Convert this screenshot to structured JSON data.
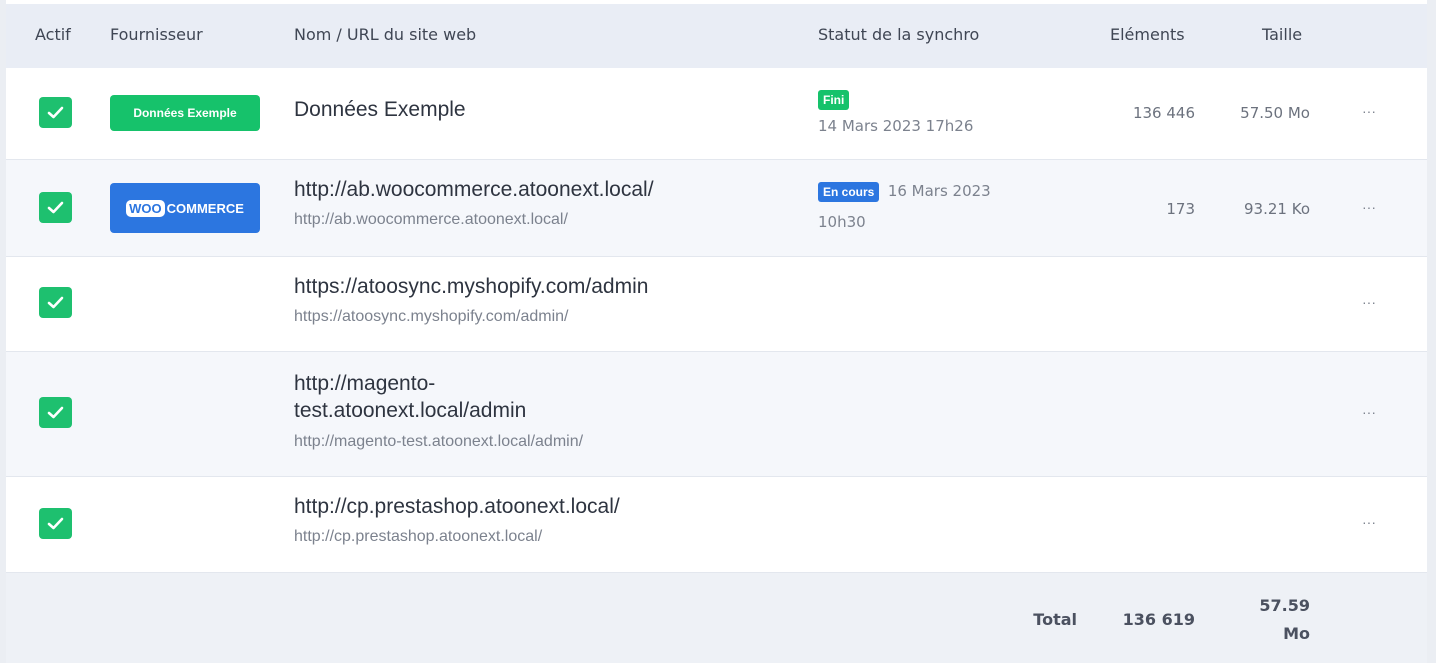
{
  "header": {
    "actif": "Actif",
    "fournisseur": "Fournisseur",
    "nom": "Nom / URL du site web",
    "statut": "Statut de la synchro",
    "elements": "Eléments",
    "taille": "Taille"
  },
  "rows": [
    {
      "active": true,
      "provider": "Données Exemple",
      "name": "Données Exemple",
      "url": "",
      "status_label": "Fini",
      "status_date": "14 Mars 2023 17h26",
      "elements": "136 446",
      "size": "57.50 Mo",
      "menu": "···"
    },
    {
      "active": true,
      "provider_mark": "WOO",
      "provider_text": "COMMERCE",
      "name": "http://ab.woocommerce.atoonext.local/",
      "url": "http://ab.woocommerce.atoonext.local/",
      "status_label": "En cours",
      "status_date_1": "16 Mars 2023",
      "status_date_2": "10h30",
      "elements": "173",
      "size": "93.21 Ko",
      "menu": "···"
    },
    {
      "active": true,
      "name": "https://atoosync.myshopify.com/admin",
      "url": "https://atoosync.myshopify.com/admin/",
      "menu": "···"
    },
    {
      "active": true,
      "name_1": "http://magento-",
      "name_2": "test.atoonext.local/admin",
      "url": "http://magento-test.atoonext.local/admin/",
      "menu": "···"
    },
    {
      "active": true,
      "name": "http://cp.prestashop.atoonext.local/",
      "url": "http://cp.prestashop.atoonext.local/",
      "menu": "···"
    }
  ],
  "footer": {
    "total_label": "Total",
    "total_elements": "136 619",
    "total_size_1": "57.59",
    "total_size_2": "Mo"
  },
  "colors": {
    "accent_green": "#1ec06f",
    "accent_blue": "#2c76e0"
  },
  "icons": {
    "checkbox": "check-icon",
    "row_menu": "more-horizontal-icon"
  }
}
